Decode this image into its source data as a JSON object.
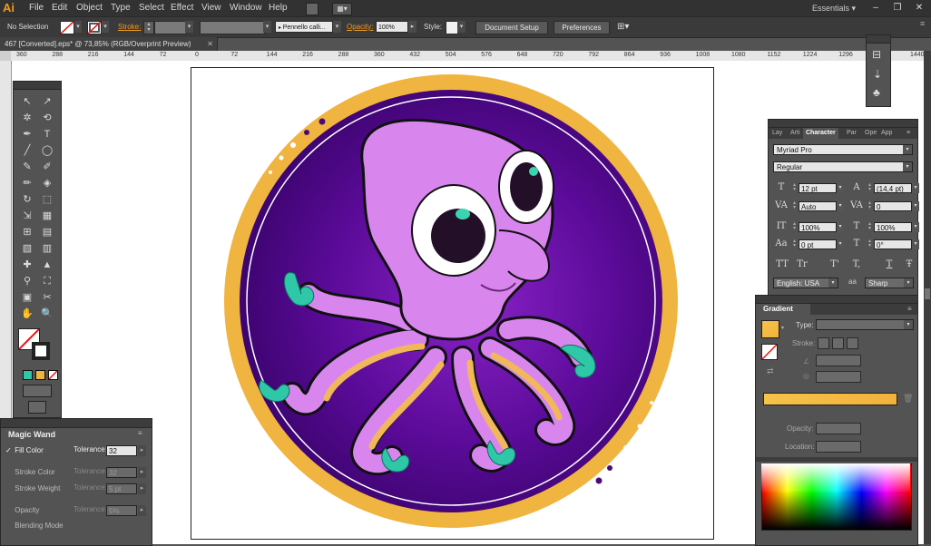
{
  "app": {
    "logo": "Ai",
    "workspace": "Essentials"
  },
  "menu": [
    "File",
    "Edit",
    "Object",
    "Type",
    "Select",
    "Effect",
    "View",
    "Window",
    "Help"
  ],
  "window_controls": [
    "–",
    "❐",
    "✕"
  ],
  "control_bar": {
    "selection": "No Selection",
    "stroke_label": "Stroke:",
    "brush": "Pennello calli...",
    "opacity_label": "Opacity:",
    "opacity_value": "100%",
    "style_label": "Style:",
    "document_setup": "Document Setup",
    "preferences": "Preferences"
  },
  "document_tab": {
    "title": "467 [Converted].eps* @ 73,85% (RGB/Overprint Preview)",
    "close": "✕"
  },
  "ruler_ticks": [
    "360",
    "288",
    "216",
    "144",
    "72",
    "0",
    "72",
    "144",
    "216",
    "288",
    "360",
    "432",
    "504",
    "576",
    "648",
    "720",
    "792",
    "864",
    "936",
    "1008",
    "1080",
    "1152",
    "1224",
    "1296",
    "1368",
    "1440"
  ],
  "tools": [
    "↖",
    "↗",
    "✲",
    "⟲",
    "✒",
    "T",
    "╱",
    "◯",
    "✎",
    "✐",
    "✏",
    "◈",
    "↻",
    "⬚",
    "⇲",
    "▦",
    "⊞",
    "▤",
    "▧",
    "▥",
    "✚",
    "▲",
    "⚲",
    "⛶",
    "▣",
    "✂",
    "✋",
    "🔍"
  ],
  "magic_wand": {
    "title": "Magic Wand",
    "rows": [
      {
        "label": "Fill Color",
        "checked": "✓",
        "tolerance_label": "Tolerance:",
        "value": "32",
        "enabled": true
      },
      {
        "label": "Stroke Color",
        "checked": "",
        "tolerance_label": "Tolerance:",
        "value": "32",
        "enabled": false
      },
      {
        "label": "Stroke Weight",
        "checked": "",
        "tolerance_label": "Tolerance:",
        "value": "5 pt",
        "enabled": false
      },
      {
        "label": "Opacity",
        "checked": "",
        "tolerance_label": "Tolerance:",
        "value": "5%",
        "enabled": false
      },
      {
        "label": "Blending Mode",
        "checked": "",
        "tolerance_label": "",
        "value": "",
        "enabled": false
      }
    ]
  },
  "character": {
    "tabs": [
      "Lay",
      "Arti",
      "Character",
      "Par",
      "Ope",
      "App"
    ],
    "font": "Myriad Pro",
    "style": "Regular",
    "fields": [
      {
        "icon": "T",
        "value": "12 pt"
      },
      {
        "icon": "A",
        "value": "(14,4 pt)"
      },
      {
        "icon": "VA",
        "value": "Auto"
      },
      {
        "icon": "VA",
        "value": "0"
      },
      {
        "icon": "IT",
        "value": "100%"
      },
      {
        "icon": "T",
        "value": "100%"
      },
      {
        "icon": "Aa",
        "value": "0 pt"
      },
      {
        "icon": "T",
        "value": "0°"
      }
    ],
    "type_buttons": [
      "TT",
      "Tr",
      "T'",
      "T,",
      "T",
      "Ŧ"
    ],
    "language": "English: USA",
    "aa_label": "aa",
    "antialias": "Sharp"
  },
  "gradient": {
    "title": "Gradient",
    "type_label": "Type:",
    "stroke_label": "Stroke:",
    "opacity_label": "Opacity:",
    "location_label": "Location:",
    "start_color": "#f6c24a",
    "end_color": "#f2b23c"
  },
  "colors": {
    "ring": "#f0b440",
    "disc_dark": "#3d0470",
    "disc_light": "#7a18b8",
    "octopus": "#d886ee",
    "octopus_shade": "#b35cd6",
    "suckers": "#f0b85a",
    "teal": "#2ec7a8",
    "accent": "#f39a1e"
  }
}
